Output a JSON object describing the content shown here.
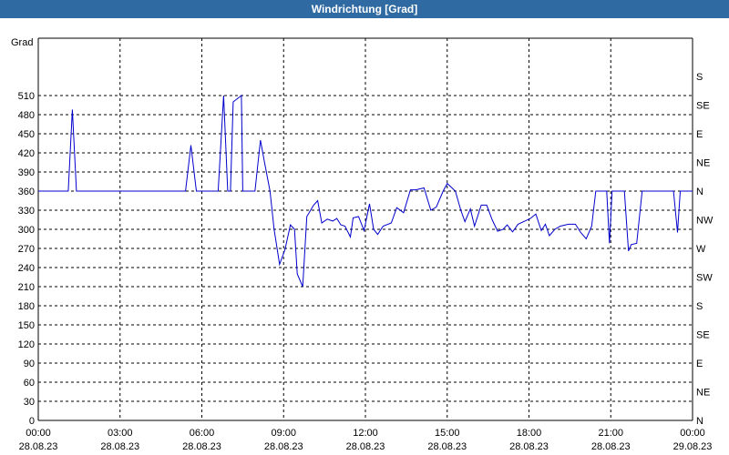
{
  "window": {
    "title": "Windrichtung [Grad]"
  },
  "colors": {
    "titlebar": "#2f6aa3",
    "line": "#0000cc",
    "grid": "#000000"
  },
  "chart_data": {
    "type": "line",
    "title": "Windrichtung [Grad]",
    "ylabel": "Grad",
    "ylim": [
      0,
      510
    ],
    "xlim_hours": [
      0,
      24
    ],
    "grid": true,
    "yticks": [
      0,
      30,
      60,
      90,
      120,
      150,
      180,
      210,
      240,
      270,
      300,
      330,
      360,
      390,
      420,
      450,
      480,
      510
    ],
    "right_ticks": [
      {
        "value": 0,
        "label": "N"
      },
      {
        "value": 45,
        "label": "NE"
      },
      {
        "value": 90,
        "label": "E"
      },
      {
        "value": 135,
        "label": "SE"
      },
      {
        "value": 180,
        "label": "S"
      },
      {
        "value": 225,
        "label": "SW"
      },
      {
        "value": 270,
        "label": "W"
      },
      {
        "value": 315,
        "label": "NW"
      },
      {
        "value": 360,
        "label": "N"
      },
      {
        "value": 405,
        "label": "NE"
      },
      {
        "value": 450,
        "label": "E"
      },
      {
        "value": 495,
        "label": "SE"
      },
      {
        "value": 540,
        "label": "S"
      }
    ],
    "xticks": [
      {
        "time": "00:00",
        "date": "28.08.23"
      },
      {
        "time": "03:00",
        "date": "28.08.23"
      },
      {
        "time": "06:00",
        "date": "28.08.23"
      },
      {
        "time": "09:00",
        "date": "28.08.23"
      },
      {
        "time": "12:00",
        "date": "28.08.23"
      },
      {
        "time": "15:00",
        "date": "28.08.23"
      },
      {
        "time": "18:00",
        "date": "28.08.23"
      },
      {
        "time": "21:00",
        "date": "28.08.23"
      },
      {
        "time": "00:00",
        "date": "29.08.23"
      }
    ],
    "series": [
      {
        "values": [
          [
            0.0,
            360
          ],
          [
            1.1,
            360
          ],
          [
            1.25,
            488
          ],
          [
            1.4,
            360
          ],
          [
            2.5,
            360
          ],
          [
            3.5,
            360
          ],
          [
            4.5,
            360
          ],
          [
            5.4,
            360
          ],
          [
            5.6,
            432
          ],
          [
            5.8,
            360
          ],
          [
            6.5,
            360
          ],
          [
            6.6,
            360
          ],
          [
            6.8,
            510
          ],
          [
            6.95,
            360
          ],
          [
            7.05,
            360
          ],
          [
            7.15,
            500
          ],
          [
            7.3,
            505
          ],
          [
            7.45,
            510
          ],
          [
            7.5,
            360
          ],
          [
            7.95,
            360
          ],
          [
            8.15,
            440
          ],
          [
            8.3,
            405
          ],
          [
            8.5,
            360
          ],
          [
            8.65,
            300
          ],
          [
            8.85,
            245
          ],
          [
            9.05,
            268
          ],
          [
            9.25,
            307
          ],
          [
            9.4,
            300
          ],
          [
            9.5,
            230
          ],
          [
            9.7,
            210
          ],
          [
            9.85,
            320
          ],
          [
            10.1,
            338
          ],
          [
            10.25,
            345
          ],
          [
            10.4,
            310
          ],
          [
            10.6,
            316
          ],
          [
            10.8,
            313
          ],
          [
            10.95,
            317
          ],
          [
            11.1,
            307
          ],
          [
            11.25,
            305
          ],
          [
            11.45,
            288
          ],
          [
            11.55,
            318
          ],
          [
            11.75,
            320
          ],
          [
            11.95,
            298
          ],
          [
            12.15,
            340
          ],
          [
            12.3,
            300
          ],
          [
            12.45,
            292
          ],
          [
            12.65,
            305
          ],
          [
            12.95,
            310
          ],
          [
            13.15,
            334
          ],
          [
            13.4,
            326
          ],
          [
            13.65,
            362
          ],
          [
            13.85,
            362
          ],
          [
            14.15,
            365
          ],
          [
            14.4,
            330
          ],
          [
            14.6,
            335
          ],
          [
            14.85,
            360
          ],
          [
            15.0,
            372
          ],
          [
            15.3,
            360
          ],
          [
            15.5,
            330
          ],
          [
            15.65,
            312
          ],
          [
            15.85,
            332
          ],
          [
            16.0,
            305
          ],
          [
            16.25,
            338
          ],
          [
            16.45,
            338
          ],
          [
            16.65,
            315
          ],
          [
            16.85,
            297
          ],
          [
            17.05,
            300
          ],
          [
            17.2,
            307
          ],
          [
            17.4,
            296
          ],
          [
            17.6,
            308
          ],
          [
            17.85,
            313
          ],
          [
            18.05,
            317
          ],
          [
            18.25,
            324
          ],
          [
            18.45,
            298
          ],
          [
            18.6,
            308
          ],
          [
            18.75,
            290
          ],
          [
            18.95,
            300
          ],
          [
            19.15,
            305
          ],
          [
            19.45,
            308
          ],
          [
            19.7,
            308
          ],
          [
            19.9,
            295
          ],
          [
            20.1,
            285
          ],
          [
            20.3,
            305
          ],
          [
            20.45,
            360
          ],
          [
            20.85,
            360
          ],
          [
            20.95,
            278
          ],
          [
            21.05,
            360
          ],
          [
            21.3,
            360
          ],
          [
            21.5,
            360
          ],
          [
            21.65,
            266
          ],
          [
            21.75,
            276
          ],
          [
            21.95,
            278
          ],
          [
            22.15,
            360
          ],
          [
            22.5,
            360
          ],
          [
            23.3,
            360
          ],
          [
            23.45,
            295
          ],
          [
            23.55,
            360
          ],
          [
            24.0,
            360
          ]
        ]
      }
    ]
  }
}
